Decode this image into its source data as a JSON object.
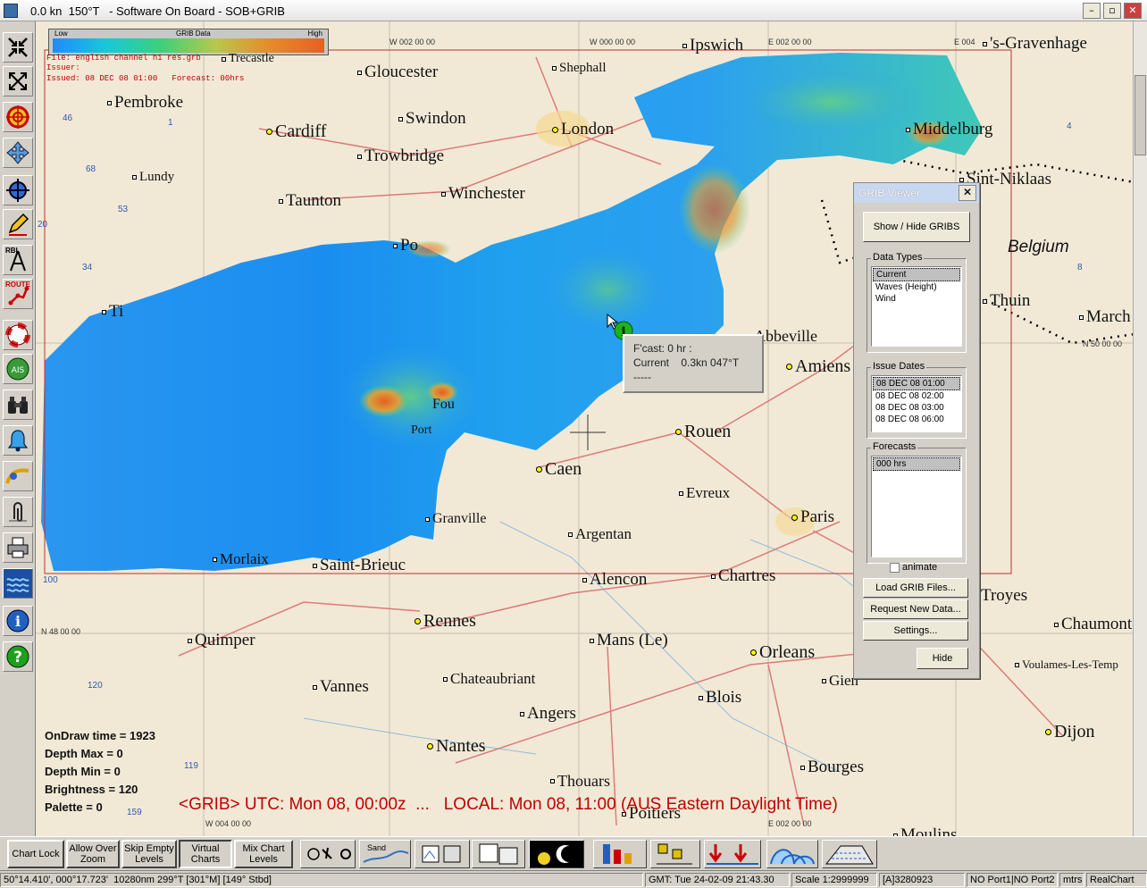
{
  "window": {
    "title": "0.0 kn  150°T   - Software On Board - SOB+GRIB"
  },
  "legend": {
    "low": "Low",
    "center": "GRIB Data",
    "high": "High"
  },
  "file_info": {
    "file": "File: english channel hi res.grb",
    "issuer": "Issuer:",
    "issued": "Issued: 08 DEC 08 01:00   Forecast: 00hrs"
  },
  "coords": {
    "w2": "W 002 00 00",
    "w0": "W 000 00 00",
    "e2": "E 002 00 00",
    "e4": "E 004",
    "n50": "N 50 00 00",
    "n48": "N 48 00 00",
    "w4": "W 004 00 00",
    "e2b": "E 002 00 00"
  },
  "places": [
    {
      "name": "Ipswich",
      "mark": "sq"
    },
    {
      "name": "'s-Gravenhage",
      "mark": "sq"
    },
    {
      "name": "Trecastle",
      "mark": "sq"
    },
    {
      "name": "Gloucester",
      "mark": "sq"
    },
    {
      "name": "Shephall",
      "mark": "sq"
    },
    {
      "name": "Pembroke",
      "mark": "sq"
    },
    {
      "name": "Swindon",
      "mark": "sq"
    },
    {
      "name": "Cardiff",
      "mark": "dot"
    },
    {
      "name": "London",
      "mark": "dot"
    },
    {
      "name": "Middelburg",
      "mark": "sq"
    },
    {
      "name": "Lundy",
      "mark": "sq"
    },
    {
      "name": "Trowbridge",
      "mark": "sq"
    },
    {
      "name": "Sint-Niklaas",
      "mark": "sq"
    },
    {
      "name": "Winchester",
      "mark": "sq"
    },
    {
      "name": "Taunton",
      "mark": "sq"
    },
    {
      "name": "Belgium",
      "mark": "none"
    },
    {
      "name": "Thuin",
      "mark": "sq"
    },
    {
      "name": "March",
      "mark": "sq"
    },
    {
      "name": "Abbeville",
      "mark": "sq"
    },
    {
      "name": "Amiens",
      "mark": "dot"
    },
    {
      "name": "Fou",
      "mark": "none"
    },
    {
      "name": "Port",
      "mark": "none"
    },
    {
      "name": "Rouen",
      "mark": "dot"
    },
    {
      "name": "Caen",
      "mark": "dot"
    },
    {
      "name": "Evreux",
      "mark": "sq"
    },
    {
      "name": "Granville",
      "mark": "sq"
    },
    {
      "name": "Argentan",
      "mark": "sq"
    },
    {
      "name": "Paris",
      "mark": "dot"
    },
    {
      "name": "Morlaix",
      "mark": "sq"
    },
    {
      "name": "Saint-Brieuc",
      "mark": "sq"
    },
    {
      "name": "Alencon",
      "mark": "sq"
    },
    {
      "name": "Chartres",
      "mark": "sq"
    },
    {
      "name": "Rennes",
      "mark": "dot"
    },
    {
      "name": "Quimper",
      "mark": "sq"
    },
    {
      "name": "Mans (Le)",
      "mark": "sq"
    },
    {
      "name": "Orleans",
      "mark": "dot"
    },
    {
      "name": "Chaumont",
      "mark": "sq"
    },
    {
      "name": "Voulames-Les-Temp",
      "mark": "sq"
    },
    {
      "name": "Vannes",
      "mark": "sq"
    },
    {
      "name": "Chateaubriant",
      "mark": "sq"
    },
    {
      "name": "Blois",
      "mark": "sq"
    },
    {
      "name": "Angers",
      "mark": "sq"
    },
    {
      "name": "Nantes",
      "mark": "dot"
    },
    {
      "name": "Bourges",
      "mark": "sq"
    },
    {
      "name": "Dijon",
      "mark": "dot"
    },
    {
      "name": "Thouars",
      "mark": "sq"
    },
    {
      "name": "Poitiers",
      "mark": "sq"
    },
    {
      "name": "Moulins",
      "mark": "sq"
    },
    {
      "name": "Gien",
      "mark": "sq"
    },
    {
      "name": "Troyes",
      "mark": "sq"
    },
    {
      "name": "Ti",
      "mark": "sq"
    },
    {
      "name": "Po",
      "mark": "sq"
    }
  ],
  "depths": [
    "46",
    "1",
    "68",
    "53",
    "34",
    "20",
    "100",
    "120",
    "119",
    "159",
    "4",
    "8"
  ],
  "stats": {
    "ondraw": "OnDraw time = 1923",
    "depth_max": "Depth Max = 0",
    "depth_min": "Depth Min = 0",
    "brightness": "Brightness = 120",
    "palette": "Palette = 0"
  },
  "grib_line": "<GRIB> UTC: Mon 08, 00:00z  ...   LOCAL: Mon 08, 11:00 (AUS Eastern Daylight Time)",
  "tooltip": {
    "line1": "F'cast: 0 hr :",
    "line2": "Current    0.3kn 047°T",
    "line3": "-----"
  },
  "grib_viewer": {
    "title": "GRIB Viewer",
    "close": "✕",
    "show_hide": "Show / Hide  GRIBS",
    "data_types_label": "Data Types",
    "data_types": [
      "Current",
      "Waves (Height)",
      "Wind"
    ],
    "issue_dates_label": "Issue Dates",
    "issue_dates": [
      "08 DEC 08 01:00",
      "08 DEC 08 02:00",
      "08 DEC 08 03:00",
      "08 DEC 08 06:00"
    ],
    "forecasts_label": "Forecasts",
    "forecasts": [
      "000 hrs"
    ],
    "animate": "animate",
    "load": "Load GRIB Files...",
    "request": "Request New Data...",
    "settings": "Settings...",
    "hide": "Hide"
  },
  "bottom_buttons": {
    "chart_lock": "Chart Lock",
    "allow_over_zoom": "Allow Over Zoom",
    "skip_empty": "Skip Empty Levels",
    "virtual_charts": "Virtual Charts",
    "mix_chart": "Mix Chart Levels",
    "sand": "Sand"
  },
  "status": {
    "position": "50°14.410', 000°17.723'  10280nm 299°T [301°M] [149° Stbd]",
    "gmt": "GMT: Tue 24-02-09  21:43.30",
    "scale": "Scale 1:2999999",
    "id": "[A]3280923",
    "ports": "NO Port1|NO Port2",
    "units": "mtrs",
    "mode": "RealChart"
  },
  "toolbar_labels": {
    "rbl": "RBL",
    "route": "ROUTE"
  },
  "colors": {
    "sea_low": "#1e8cff",
    "sea_high": "#e86020",
    "land": "#f1e9d6",
    "grib_title": "#c8d8f0",
    "text_red": "#c00000"
  }
}
